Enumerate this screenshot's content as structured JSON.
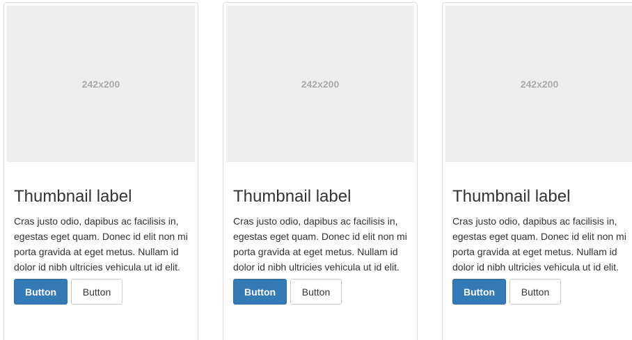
{
  "thumbnails": [
    {
      "placeholder": "242x200",
      "label": "Thumbnail label",
      "text": "Cras justo odio, dapibus ac facilisis in, egestas eget quam. Donec id elit non mi porta gravida at eget metus. Nullam id dolor id nibh ultricies vehicula ut id elit.",
      "primary_button": "Button",
      "default_button": "Button"
    },
    {
      "placeholder": "242x200",
      "label": "Thumbnail label",
      "text": "Cras justo odio, dapibus ac facilisis in, egestas eget quam. Donec id elit non mi porta gravida at eget metus. Nullam id dolor id nibh ultricies vehicula ut id elit.",
      "primary_button": "Button",
      "default_button": "Button"
    },
    {
      "placeholder": "242x200",
      "label": "Thumbnail label",
      "text": "Cras justo odio, dapibus ac facilisis in, egestas eget quam. Donec id elit non mi porta gravida at eget metus. Nullam id dolor id nibh ultricies vehicula ut id elit.",
      "primary_button": "Button",
      "default_button": "Button"
    }
  ],
  "colors": {
    "primary": "#337ab7",
    "placeholder_bg": "#eeeeee",
    "placeholder_text": "#aaaaaa",
    "border": "#dddddd"
  }
}
